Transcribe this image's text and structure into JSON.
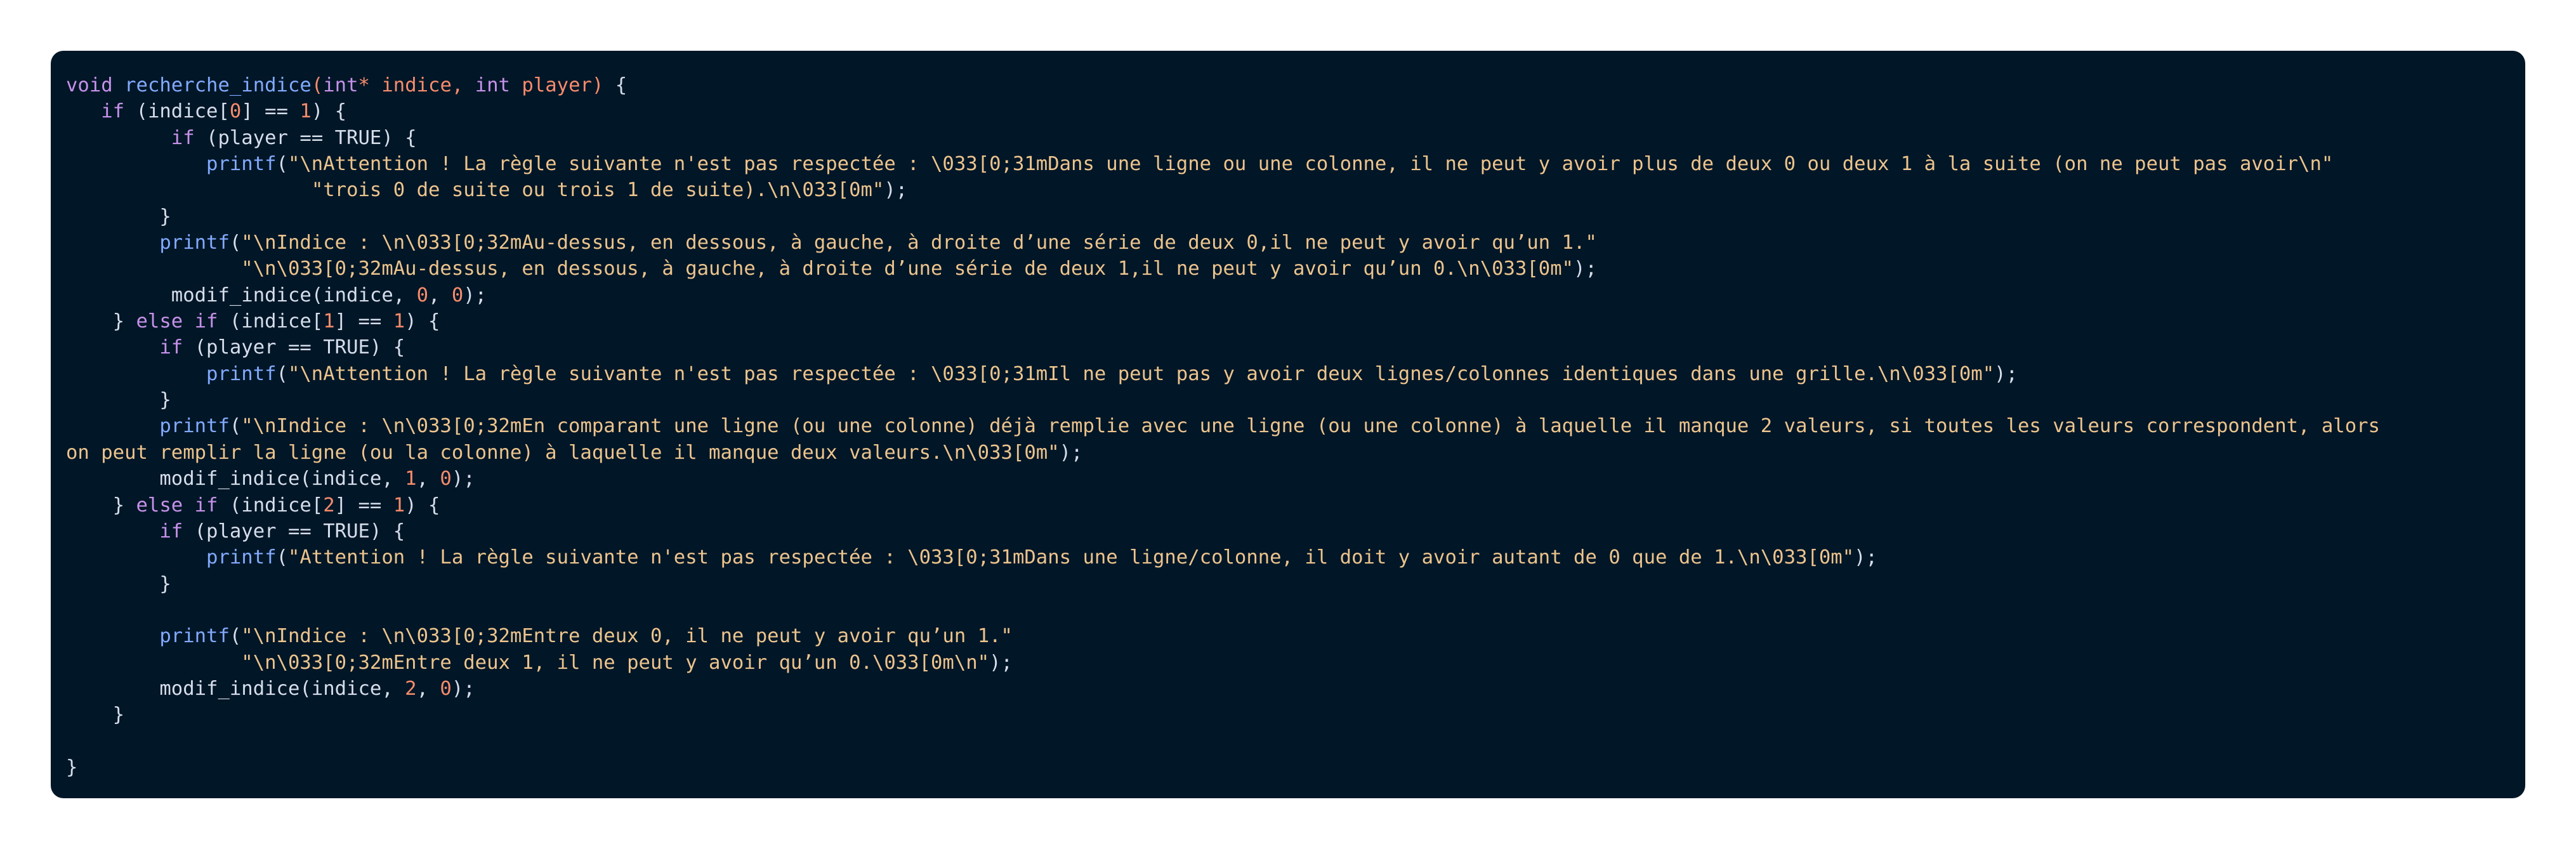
{
  "code": {
    "lines": [
      [
        {
          "t": "void",
          "c": "kw"
        },
        {
          "t": " ",
          "c": "plain"
        },
        {
          "t": "recherche_indice",
          "c": "fn"
        },
        {
          "t": "(",
          "c": "op"
        },
        {
          "t": "int",
          "c": "kw"
        },
        {
          "t": "*",
          "c": "op"
        },
        {
          "t": " indice",
          "c": "param"
        },
        {
          "t": ", ",
          "c": "op"
        },
        {
          "t": "int",
          "c": "kw"
        },
        {
          "t": " player",
          "c": "param"
        },
        {
          "t": ")",
          "c": "op"
        },
        {
          "t": " {",
          "c": "plain"
        }
      ],
      [
        {
          "t": "   ",
          "c": "plain"
        },
        {
          "t": "if",
          "c": "kw"
        },
        {
          "t": " (indice[",
          "c": "plain"
        },
        {
          "t": "0",
          "c": "num"
        },
        {
          "t": "] == ",
          "c": "plain"
        },
        {
          "t": "1",
          "c": "num"
        },
        {
          "t": ") {",
          "c": "plain"
        }
      ],
      [
        {
          "t": "         ",
          "c": "plain"
        },
        {
          "t": "if",
          "c": "kw"
        },
        {
          "t": " (player == TRUE) {",
          "c": "plain"
        }
      ],
      [
        {
          "t": "            ",
          "c": "plain"
        },
        {
          "t": "printf",
          "c": "call"
        },
        {
          "t": "(",
          "c": "plain"
        },
        {
          "t": "\"\\nAttention ! La règle suivante n'est pas respectée : \\033[0;31mDans une ligne ou une colonne, il ne peut y avoir plus de deux 0 ou deux 1 à la suite (on ne peut pas avoir\\n\"",
          "c": "str"
        }
      ],
      [
        {
          "t": "                     ",
          "c": "plain"
        },
        {
          "t": "\"trois 0 de suite ou trois 1 de suite).\\n\\033[0m\"",
          "c": "str"
        },
        {
          "t": ");",
          "c": "plain"
        }
      ],
      [
        {
          "t": "        }",
          "c": "plain"
        }
      ],
      [
        {
          "t": "        ",
          "c": "plain"
        },
        {
          "t": "printf",
          "c": "call"
        },
        {
          "t": "(",
          "c": "plain"
        },
        {
          "t": "\"\\nIndice : \\n\\033[0;32mAu-dessus, en dessous, à gauche, à droite d’une série de deux 0,il ne peut y avoir qu’un 1.\"",
          "c": "str"
        }
      ],
      [
        {
          "t": "               ",
          "c": "plain"
        },
        {
          "t": "\"\\n\\033[0;32mAu-dessus, en dessous, à gauche, à droite d’une série de deux 1,il ne peut y avoir qu’un 0.\\n\\033[0m\"",
          "c": "str"
        },
        {
          "t": ");",
          "c": "plain"
        }
      ],
      [
        {
          "t": "         modif_indice(indice, ",
          "c": "plain"
        },
        {
          "t": "0",
          "c": "num"
        },
        {
          "t": ", ",
          "c": "plain"
        },
        {
          "t": "0",
          "c": "num"
        },
        {
          "t": ");",
          "c": "plain"
        }
      ],
      [
        {
          "t": "    } ",
          "c": "plain"
        },
        {
          "t": "else",
          "c": "kw"
        },
        {
          "t": " ",
          "c": "plain"
        },
        {
          "t": "if",
          "c": "kw"
        },
        {
          "t": " (indice[",
          "c": "plain"
        },
        {
          "t": "1",
          "c": "num"
        },
        {
          "t": "] == ",
          "c": "plain"
        },
        {
          "t": "1",
          "c": "num"
        },
        {
          "t": ") {",
          "c": "plain"
        }
      ],
      [
        {
          "t": "        ",
          "c": "plain"
        },
        {
          "t": "if",
          "c": "kw"
        },
        {
          "t": " (player == TRUE) {",
          "c": "plain"
        }
      ],
      [
        {
          "t": "            ",
          "c": "plain"
        },
        {
          "t": "printf",
          "c": "call"
        },
        {
          "t": "(",
          "c": "plain"
        },
        {
          "t": "\"\\nAttention ! La règle suivante n'est pas respectée : \\033[0;31mIl ne peut pas y avoir deux lignes/colonnes identiques dans une grille.\\n\\033[0m\"",
          "c": "str"
        },
        {
          "t": ");",
          "c": "plain"
        }
      ],
      [
        {
          "t": "        }",
          "c": "plain"
        }
      ],
      [
        {
          "t": "        ",
          "c": "plain"
        },
        {
          "t": "printf",
          "c": "call"
        },
        {
          "t": "(",
          "c": "plain"
        },
        {
          "t": "\"\\nIndice : \\n\\033[0;32mEn comparant une ligne (ou une colonne) déjà remplie avec une ligne (ou une colonne) à laquelle il manque 2 valeurs, si toutes les valeurs correspondent, alors",
          "c": "str"
        }
      ],
      [
        {
          "t": "on peut remplir la ligne (ou la colonne) à laquelle il manque deux valeurs.\\n\\033[0m\"",
          "c": "str"
        },
        {
          "t": ");",
          "c": "plain"
        }
      ],
      [
        {
          "t": "        modif_indice(indice, ",
          "c": "plain"
        },
        {
          "t": "1",
          "c": "num"
        },
        {
          "t": ", ",
          "c": "plain"
        },
        {
          "t": "0",
          "c": "num"
        },
        {
          "t": ");",
          "c": "plain"
        }
      ],
      [
        {
          "t": "    } ",
          "c": "plain"
        },
        {
          "t": "else",
          "c": "kw"
        },
        {
          "t": " ",
          "c": "plain"
        },
        {
          "t": "if",
          "c": "kw"
        },
        {
          "t": " (indice[",
          "c": "plain"
        },
        {
          "t": "2",
          "c": "num"
        },
        {
          "t": "] == ",
          "c": "plain"
        },
        {
          "t": "1",
          "c": "num"
        },
        {
          "t": ") {",
          "c": "plain"
        }
      ],
      [
        {
          "t": "        ",
          "c": "plain"
        },
        {
          "t": "if",
          "c": "kw"
        },
        {
          "t": " (player == TRUE) {",
          "c": "plain"
        }
      ],
      [
        {
          "t": "            ",
          "c": "plain"
        },
        {
          "t": "printf",
          "c": "call"
        },
        {
          "t": "(",
          "c": "plain"
        },
        {
          "t": "\"Attention ! La règle suivante n'est pas respectée : \\033[0;31mDans une ligne/colonne, il doit y avoir autant de 0 que de 1.\\n\\033[0m\"",
          "c": "str"
        },
        {
          "t": ");",
          "c": "plain"
        }
      ],
      [
        {
          "t": "        }",
          "c": "plain"
        }
      ],
      [
        {
          "t": "",
          "c": "plain"
        }
      ],
      [
        {
          "t": "        ",
          "c": "plain"
        },
        {
          "t": "printf",
          "c": "call"
        },
        {
          "t": "(",
          "c": "plain"
        },
        {
          "t": "\"\\nIndice : \\n\\033[0;32mEntre deux 0, il ne peut y avoir qu’un 1.\"",
          "c": "str"
        }
      ],
      [
        {
          "t": "               ",
          "c": "plain"
        },
        {
          "t": "\"\\n\\033[0;32mEntre deux 1, il ne peut y avoir qu’un 0.\\033[0m\\n\"",
          "c": "str"
        },
        {
          "t": ");",
          "c": "plain"
        }
      ],
      [
        {
          "t": "        modif_indice(indice, ",
          "c": "plain"
        },
        {
          "t": "2",
          "c": "num"
        },
        {
          "t": ", ",
          "c": "plain"
        },
        {
          "t": "0",
          "c": "num"
        },
        {
          "t": ");",
          "c": "plain"
        }
      ],
      [
        {
          "t": "    }",
          "c": "plain"
        }
      ],
      [
        {
          "t": "",
          "c": "plain"
        }
      ],
      [
        {
          "t": "}",
          "c": "plain"
        }
      ]
    ]
  },
  "theme": {
    "background": "#011627",
    "text": "#d6deeb",
    "keyword": "#c792ea",
    "function": "#82aaff",
    "string": "#ecc48d",
    "number": "#f78c6c"
  }
}
